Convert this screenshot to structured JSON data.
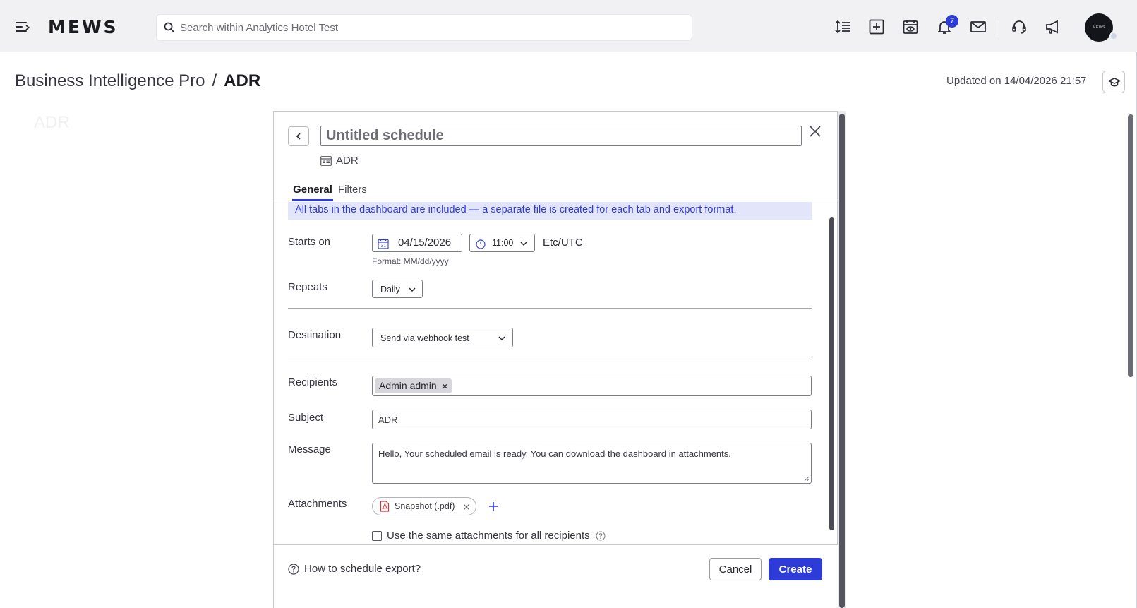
{
  "topbar": {
    "logo": "MEWS",
    "search_placeholder": "Search within Analytics Hotel Test",
    "notification_count": "7",
    "avatar_text": "MEWS",
    "icons": [
      "menu-icon",
      "search-icon",
      "sort-lines-icon",
      "add-square-icon",
      "calendar-eye-icon",
      "bell-icon",
      "mail-icon",
      "headset-icon",
      "megaphone-icon"
    ]
  },
  "page": {
    "breadcrumb_parent": "Business Intelligence Pro",
    "breadcrumb_separator": "/",
    "breadcrumb_current": "ADR",
    "updated": "Updated on 14/04/2026 21:57"
  },
  "modal": {
    "title_placeholder": "Untitled schedule",
    "dashboard_name": "ADR",
    "tabs": [
      {
        "label": "General",
        "active": true
      },
      {
        "label": "Filters",
        "active": false
      }
    ],
    "info_banner": "All tabs in the dashboard are included — a separate file is created for each tab and export format.",
    "starts_on": {
      "label": "Starts on",
      "date": "04/15/2026",
      "time": "11:00",
      "timezone": "Etc/UTC",
      "format_hint": "Format: MM/dd/yyyy"
    },
    "repeats": {
      "label": "Repeats",
      "value": "Daily"
    },
    "destination": {
      "label": "Destination",
      "value": "Send via webhook test"
    },
    "recipients": {
      "label": "Recipients",
      "chips": [
        "Admin admin"
      ],
      "chip_remove": "×"
    },
    "subject": {
      "label": "Subject",
      "value": "ADR"
    },
    "message": {
      "label": "Message",
      "value": "Hello, Your scheduled email is ready. You can download the dashboard in attachments."
    },
    "attachments": {
      "label": "Attachments",
      "items": [
        "Snapshot (.pdf)"
      ]
    },
    "same_attachments_label": "Use the same attachments for all recipients",
    "same_attachments_checked": false,
    "help_link": "How to schedule export?",
    "cancel_label": "Cancel",
    "create_label": "Create"
  },
  "colors": {
    "accent": "#2d3bd9",
    "banner_bg": "#e3e5fb",
    "topbar_bg": "#f1f1f3"
  }
}
